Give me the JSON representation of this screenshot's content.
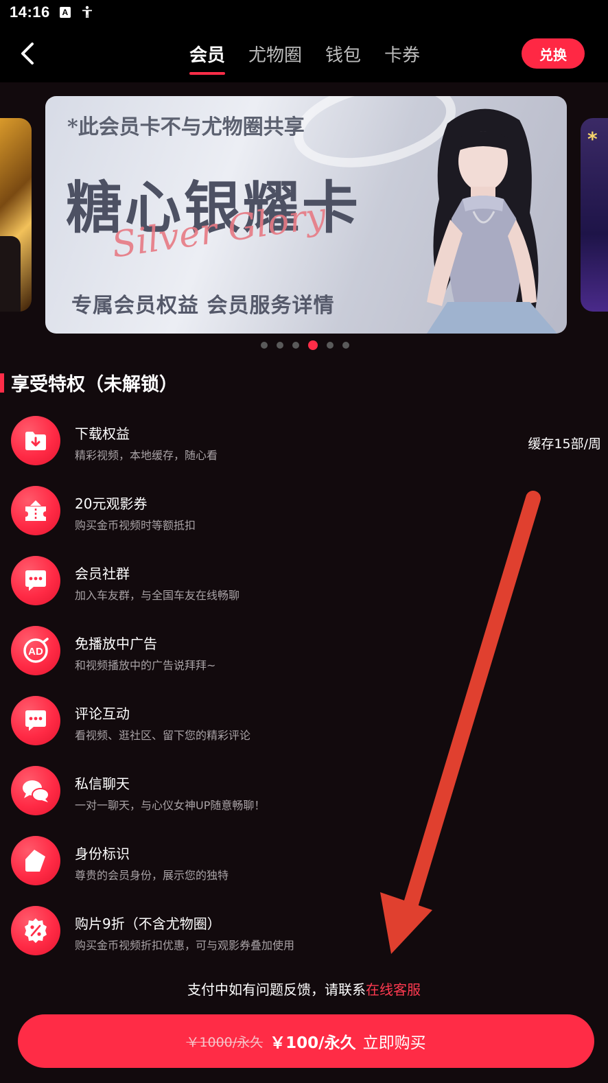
{
  "status_bar": {
    "time": "14:16",
    "icons": [
      "a-badge-icon",
      "accessibility-icon"
    ]
  },
  "header": {
    "back_icon": "chevron-left-icon",
    "tabs": [
      {
        "label": "会员",
        "active": true
      },
      {
        "label": "尤物圈",
        "active": false
      },
      {
        "label": "钱包",
        "active": false
      },
      {
        "label": "卡券",
        "active": false
      }
    ],
    "redeem_label": "兑换"
  },
  "banner": {
    "note": "*此会员卡不与尤物圈共享",
    "title": "糖心银耀卡",
    "script": "Silver Glory",
    "subtitle": "专属会员权益  会员服务详情",
    "dot_count": 6,
    "active_dot": 3
  },
  "privileges": {
    "title": "享受特权（未解锁）",
    "items": [
      {
        "name": "下载权益",
        "desc": "精彩视频，本地缓存，随心看",
        "extra": "缓存15部/周",
        "icon": "download-folder-icon"
      },
      {
        "name": "20元观影券",
        "desc": "购买金币视频时等额抵扣",
        "extra": "",
        "icon": "ticket-icon"
      },
      {
        "name": "会员社群",
        "desc": "加入车友群，与全国车友在线畅聊",
        "extra": "",
        "icon": "chat-bubble-icon"
      },
      {
        "name": "免播放中广告",
        "desc": "和视频播放中的广告说拜拜~",
        "extra": "",
        "icon": "no-ad-icon"
      },
      {
        "name": "评论互动",
        "desc": "看视频、逛社区、留下您的精彩评论",
        "extra": "",
        "icon": "comment-icon"
      },
      {
        "name": "私信聊天",
        "desc": "一对一聊天，与心仪女神UP随意畅聊！",
        "extra": "",
        "icon": "chat-bubbles-icon"
      },
      {
        "name": "身份标识",
        "desc": "尊贵的会员身份，展示您的独特",
        "extra": "",
        "icon": "badge-tag-icon"
      },
      {
        "name": "购片9折（不含尤物圈）",
        "desc": "购买金币视频折扣优惠，可与观影券叠加使用",
        "extra": "",
        "icon": "discount-icon"
      }
    ]
  },
  "footer": {
    "support_text": "支付中如有问题反馈，请联系",
    "support_link": "在线客服",
    "old_price": "￥1000/永久",
    "new_price": "￥100/永久",
    "buy_label": "立即购买"
  },
  "colors": {
    "accent": "#ff2d48",
    "background": "#120a0d"
  }
}
